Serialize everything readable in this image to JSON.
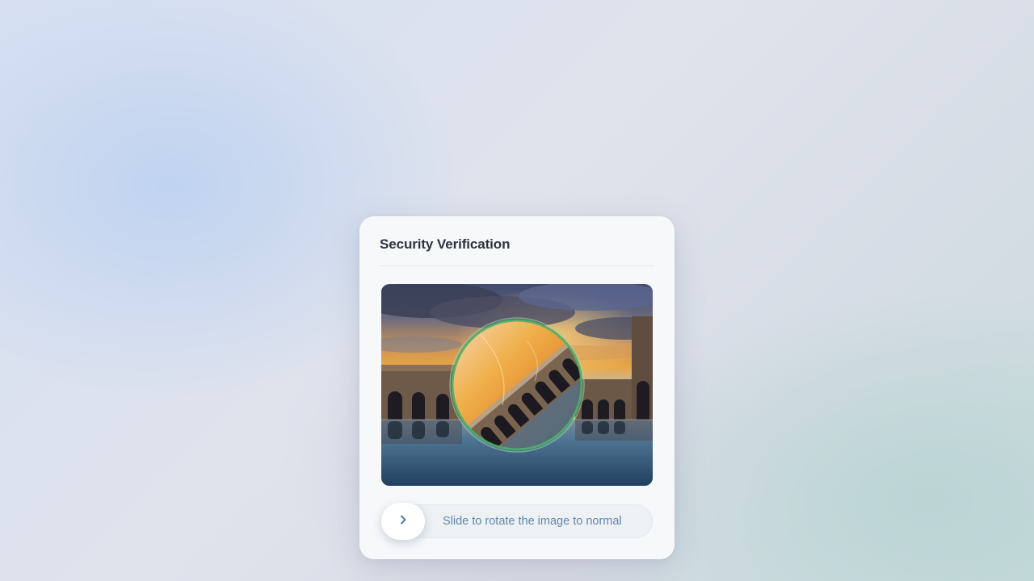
{
  "dialog": {
    "title": "Security Verification"
  },
  "puzzle": {
    "image_alt": "Courtyard with arcades reflected in water at sunset",
    "rotated_piece_alt": "Rotated circular piece of the image"
  },
  "slider": {
    "instruction": "Slide to rotate the image to normal",
    "handle_icon": "chevron-right-icon"
  },
  "colors": {
    "ring": "#4caf6a",
    "slider_text": "#5f86ad",
    "chevron": "#4f7eab"
  }
}
